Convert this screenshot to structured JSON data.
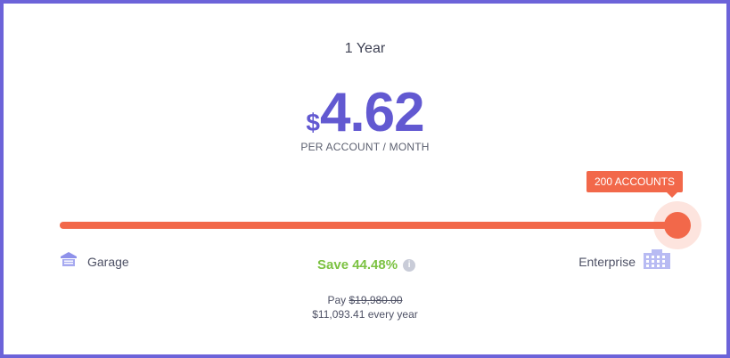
{
  "plan": {
    "period": "1 Year",
    "currency_symbol": "$",
    "price": "4.62",
    "per_unit": "PER ACCOUNT / MONTH"
  },
  "slider": {
    "tooltip": "200 ACCOUNTS",
    "level": 1.0,
    "min_label": "Garage",
    "max_label": "Enterprise",
    "min_icon": "garage-icon",
    "max_icon": "building-icon"
  },
  "savings": {
    "label": "Save 44.48%",
    "info_icon": "info-icon"
  },
  "billing": {
    "pay_prefix": "Pay ",
    "original_price": "$19,980.00",
    "yearly_total": "$11,093.41 every year"
  },
  "colors": {
    "accent": "#6259d1",
    "slider": "#f2684a",
    "save": "#7cc242",
    "border": "#6c63d9"
  }
}
